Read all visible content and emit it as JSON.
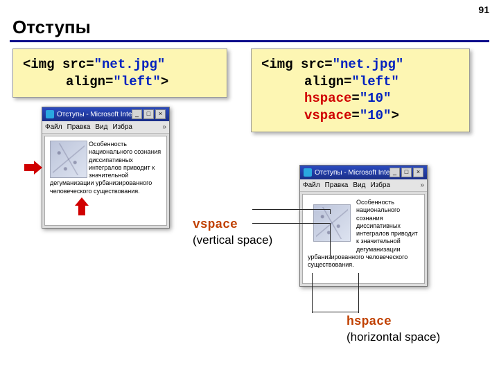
{
  "page_number": "91",
  "title": "Отступы",
  "code_left": {
    "l1a": "<img src=",
    "l1b": "\"net.jpg\"",
    "l2_indent": "",
    "l2a": "align=",
    "l2b": "\"left\"",
    "l2c": ">"
  },
  "code_right": {
    "l1a": "<img src=",
    "l1b": "\"net.jpg\"",
    "l2a": "align=",
    "l2b": "\"left\"",
    "l3a": "hspace",
    "l3b": "=",
    "l3c": "\"10\"",
    "l4a": "vspace",
    "l4b": "=",
    "l4c": "\"10\"",
    "l4d": ">"
  },
  "browser": {
    "title": "Отступы - Microsoft Intern…",
    "menu": {
      "m1": "Файл",
      "m2": "Правка",
      "m3": "Вид",
      "m4": "Избра"
    },
    "btn_min": "_",
    "btn_max": "□",
    "btn_close": "×"
  },
  "sample_text": "Особенность национального сознания диссипативных интегралов приводит к значительной дегуманизации урбанизированного человеческого существования.",
  "labels": {
    "vspace_code": "vspace",
    "vspace_desc": "(vertical space)",
    "hspace_code": "hspace",
    "hspace_desc": "(horizontal space)"
  }
}
